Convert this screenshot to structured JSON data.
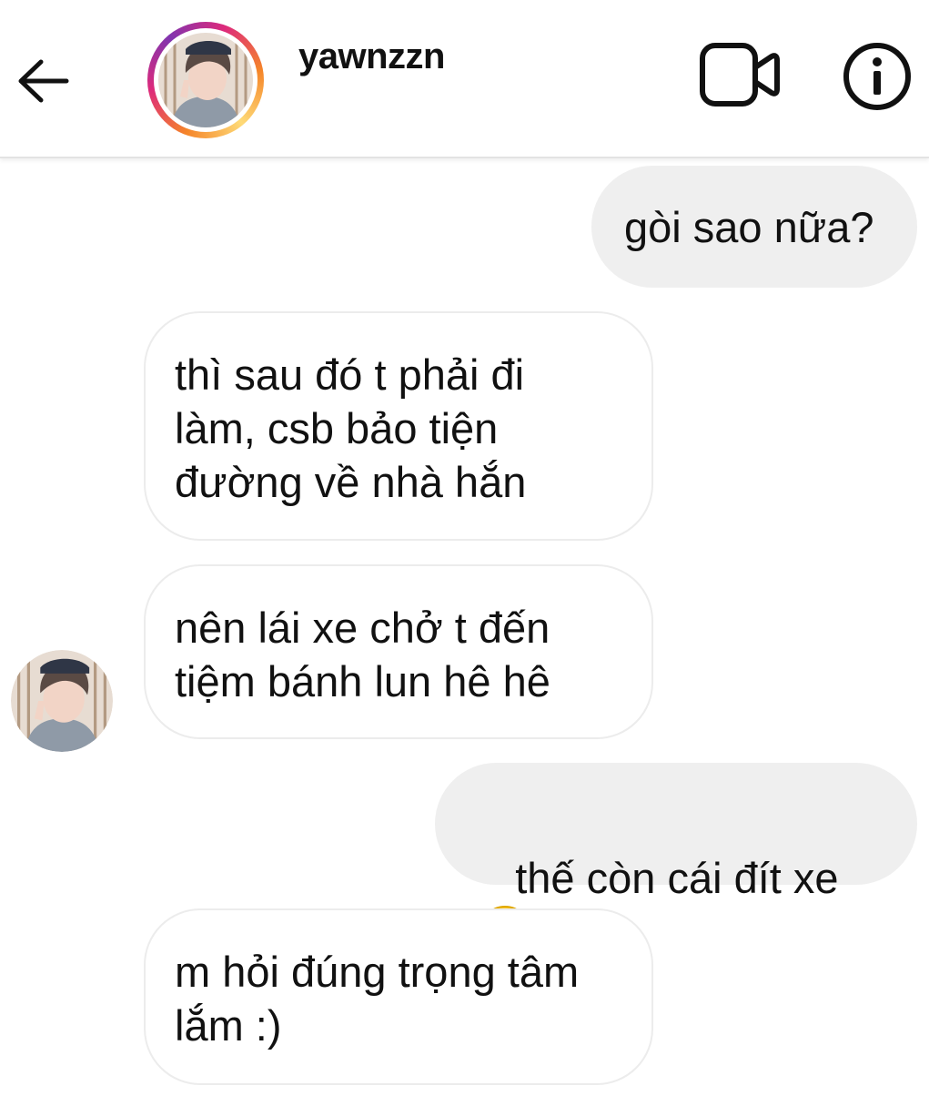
{
  "header": {
    "back_icon": "arrow-left-icon",
    "username": "yawnzzn",
    "video_icon": "video-camera-icon",
    "info_icon": "info-icon",
    "avatar_ring_colors": [
      "#f58529",
      "#dd2a7b",
      "#8134af",
      "#feda77"
    ]
  },
  "messages": [
    {
      "side": "outgoing",
      "text": "gòi sao nữa?"
    },
    {
      "side": "incoming",
      "text": "thì sau đó t phải đi\nlàm, csb bảo tiện\nđường về nhà hắn"
    },
    {
      "side": "incoming",
      "text": "nên lái xe chở t đến\ntiệm bánh lun hê hê"
    },
    {
      "side": "outgoing",
      "text": "thế còn cái đít xe",
      "emoji": "unamused-face-emoji"
    },
    {
      "side": "incoming",
      "text": "m hỏi đúng trọng tâm\nlắm :)"
    }
  ],
  "colors": {
    "outgoing_bubble": "#efefef",
    "incoming_bubble_border": "#ececec",
    "text": "#111111"
  }
}
